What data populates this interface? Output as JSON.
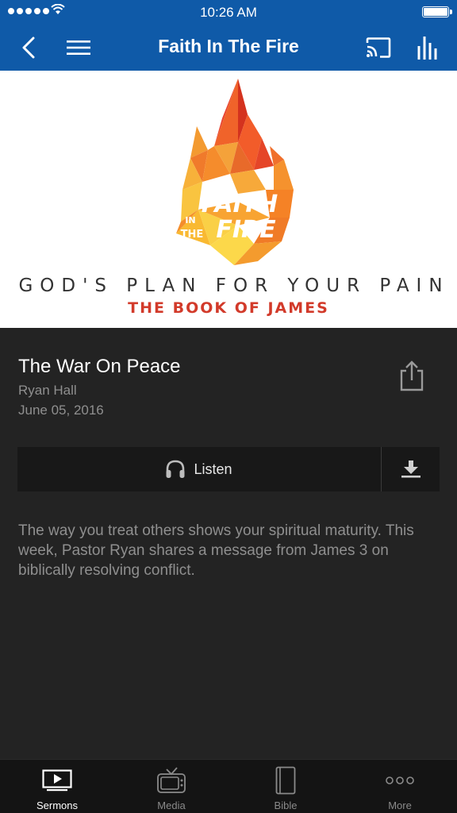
{
  "status_bar": {
    "time": "10:26 AM"
  },
  "nav": {
    "title": "Faith In The Fire",
    "back_icon": "chevron-left-icon",
    "menu_icon": "hamburger-icon",
    "cast_icon": "cast-icon",
    "stats_icon": "bar-chart-icon"
  },
  "hero": {
    "logo_text_1": "FAITH",
    "logo_text_2": "IN",
    "logo_text_3": "THE",
    "logo_text_4": "FIRE",
    "tagline": "GOD'S PLAN FOR YOUR PAIN",
    "subtitle": "THE BOOK OF JAMES"
  },
  "sermon": {
    "title": "The War On Peace",
    "speaker": "Ryan Hall",
    "date": "June 05, 2016",
    "description": "The way you treat others shows your spiritual maturity. This week, Pastor Ryan shares a message from James 3 on biblically resolving conflict."
  },
  "actions": {
    "listen_label": "Listen"
  },
  "tabs": [
    {
      "label": "Sermons",
      "icon": "tv-play-icon",
      "active": true
    },
    {
      "label": "Media",
      "icon": "television-icon",
      "active": false
    },
    {
      "label": "Bible",
      "icon": "book-icon",
      "active": false
    },
    {
      "label": "More",
      "icon": "more-dots-icon",
      "active": false
    }
  ],
  "colors": {
    "brand": "#0f5aa8",
    "background": "#232323",
    "tabbar": "#141414",
    "accent_red": "#d23a2a"
  }
}
